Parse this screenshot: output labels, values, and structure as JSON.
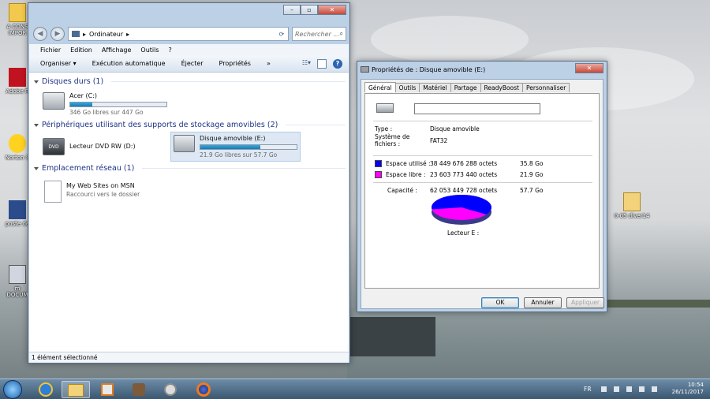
{
  "desktop": {
    "icons": [
      {
        "label": "A CONS\nIMPOR",
        "icon": "folder-icon"
      },
      {
        "label": "Adobe R",
        "icon": "adobe-reader-icon"
      },
      {
        "label": "Norton S",
        "icon": "norton-icon"
      },
      {
        "label": "poste de",
        "icon": "computer-icon"
      },
      {
        "label": "m\nDOCUM",
        "icon": "computer-icon"
      },
      {
        "label": "0-05 diver14",
        "icon": "folder-icon"
      }
    ]
  },
  "explorer": {
    "address": "Ordinateur",
    "search_placeholder": "Rechercher ...",
    "menu": [
      "Fichier",
      "Edition",
      "Affichage",
      "Outils",
      "?"
    ],
    "toolbar": [
      "Organiser ▾",
      "Exécution automatique",
      "Éjecter",
      "Propriétés",
      "»"
    ],
    "groups": {
      "hard_disks": "Disques durs (1)",
      "removable": "Périphériques utilisant des supports de stockage amovibles (2)",
      "network": "Emplacement réseau (1)"
    },
    "drives": {
      "acer": {
        "name": "Acer (C:)",
        "free": "346 Go libres sur 447 Go",
        "used_fraction": 0.23
      },
      "dvd": {
        "name": "Lecteur DVD RW (D:)",
        "badge": "DVD"
      },
      "usb": {
        "name": "Disque amovible (E:)",
        "free": "21.9 Go libres sur 57.7 Go",
        "used_fraction": 0.62
      }
    },
    "network_item": {
      "name": "My Web Sites on MSN",
      "desc": "Raccourci vers le dossier"
    },
    "status": "1 élément sélectionné"
  },
  "properties": {
    "title": "Propriétés de : Disque amovible (E:)",
    "tabs": [
      "Général",
      "Outils",
      "Matériel",
      "Partage",
      "ReadyBoost",
      "Personnaliser"
    ],
    "name_value": "",
    "type_label": "Type :",
    "type_value": "Disque amovible",
    "fs_label": "Système de fichiers :",
    "fs_value": "FAT32",
    "used_label": "Espace utilisé :",
    "used_bytes": "38 449 676 288 octets",
    "used_gb": "35.8 Go",
    "free_label": "Espace libre :",
    "free_bytes": "23 603 773 440 octets",
    "free_gb": "21.9 Go",
    "capacity_label": "Capacité :",
    "capacity_bytes": "62 053 449 728 octets",
    "capacity_gb": "57.7 Go",
    "drive_label": "Lecteur E :",
    "pie": {
      "used_fraction": 0.62,
      "used_color": "#0000ff",
      "free_color": "#ff00ff"
    },
    "buttons": {
      "ok": "OK",
      "cancel": "Annuler",
      "apply": "Appliquer"
    }
  },
  "taskbar": {
    "lang": "FR",
    "time": "10:54",
    "date": "26/11/2017"
  }
}
